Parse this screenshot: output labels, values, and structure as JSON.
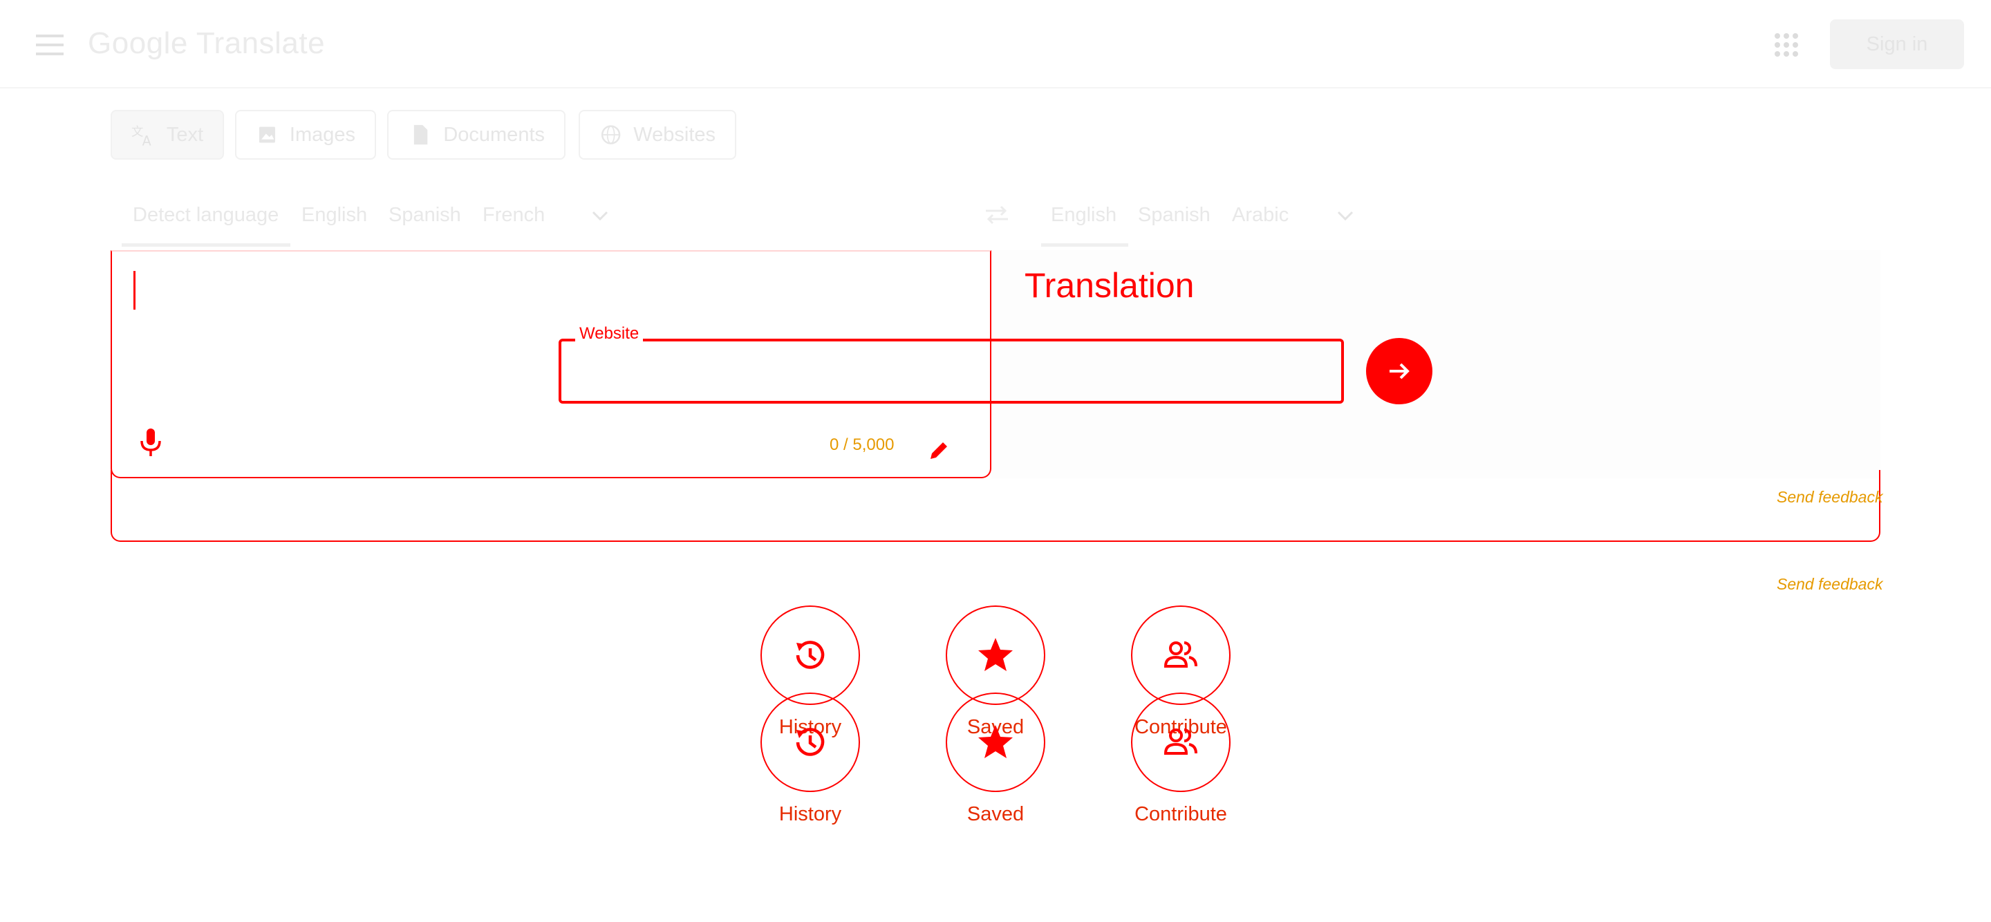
{
  "header": {
    "app_name": "Google Translate",
    "sign_in_label": "Sign in",
    "icons": [
      "hamburger-menu-icon",
      "apps-grid-icon"
    ]
  },
  "mode_tabs": [
    {
      "label": "Text",
      "icon": "translate-icon",
      "active": true
    },
    {
      "label": "Images",
      "icon": "image-icon",
      "active": false
    },
    {
      "label": "Documents",
      "icon": "document-icon",
      "active": false
    },
    {
      "label": "Websites",
      "icon": "globe-icon",
      "active": false
    }
  ],
  "source_languages": [
    "Detect language",
    "English",
    "Spanish",
    "French"
  ],
  "target_languages": [
    "English",
    "Spanish",
    "Arabic"
  ],
  "source_panel": {
    "char_count": "0 / 5,000",
    "website_label": "Website",
    "website_value": ""
  },
  "target_panel": {
    "placeholder": "Translation"
  },
  "feedback_label": "Send feedback",
  "shortcuts": [
    {
      "label": "History",
      "icon": "history-icon"
    },
    {
      "label": "Saved",
      "icon": "star-icon"
    },
    {
      "label": "Contribute",
      "icon": "people-icon"
    }
  ],
  "colors": {
    "accent": "#ff0000",
    "secondary_text": "#e69a00",
    "faint": "#ebebeb"
  }
}
